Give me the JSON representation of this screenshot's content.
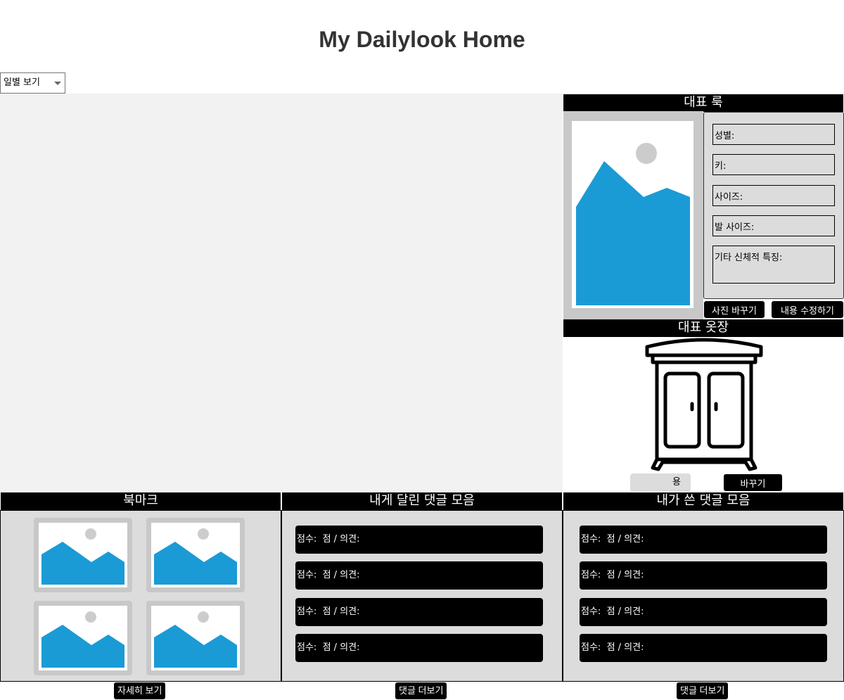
{
  "page": {
    "title": "My Dailylook Home"
  },
  "view_select": {
    "selected": "일별 보기"
  },
  "rep_look": {
    "header": "대표 룩",
    "fields": {
      "gender": "성별:",
      "height": "키:",
      "size": "사이즈:",
      "foot_size": "발 사이즈:",
      "other": "기타 신체적 특징:"
    },
    "change_photo_button": "사진 바꾸기",
    "edit_button": "내용 수정하기"
  },
  "rep_closet": {
    "header": "대표 옷장",
    "toggle_label": "용",
    "change_button": "바꾸기"
  },
  "bookmarks": {
    "header": "북마크",
    "more_button": "자세히 보기"
  },
  "received_comments": {
    "header": "내게 달린 댓글 모음",
    "items": [
      "점수:  점 / 의견:",
      "점수:  점 / 의견:",
      "점수:  점 / 의견:",
      "점수:  점 / 의견:"
    ],
    "more_button": "댓글 더보기"
  },
  "written_comments": {
    "header": "내가 쓴 댓글 모음",
    "items": [
      "점수:  점 / 의견:",
      "점수:  점 / 의견:",
      "점수:  점 / 의견:",
      "점수:  점 / 의견:"
    ],
    "more_button": "댓글 더보기"
  },
  "colors": {
    "image_sky": "#ffffff",
    "image_mountain": "#1a9bd5",
    "image_sun": "#cccccc",
    "panel_bg": "#dcdcdc",
    "calendar_bg": "#f2f2f2"
  }
}
